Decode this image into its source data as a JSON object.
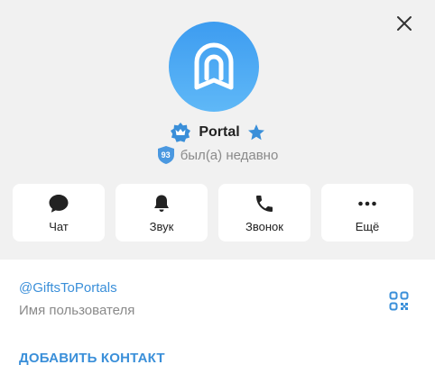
{
  "profile": {
    "name": "Portal",
    "status": "был(а) недавно",
    "level": "93"
  },
  "actions": [
    {
      "label": "Чат",
      "icon": "chat-bubble-icon"
    },
    {
      "label": "Звук",
      "icon": "bell-icon"
    },
    {
      "label": "Звонок",
      "icon": "phone-icon"
    },
    {
      "label": "Ещё",
      "icon": "more-dots-icon"
    }
  ],
  "info": {
    "username": "@GiftsToPortals",
    "username_caption": "Имя пользователя"
  },
  "add_contact_label": "ДОБАВИТЬ КОНТАКТ",
  "colors": {
    "accent": "#3a8fd9",
    "header_bg": "#f1f1f1",
    "avatar_top": "#3d9cf0",
    "avatar_bottom": "#5fb8f7"
  }
}
